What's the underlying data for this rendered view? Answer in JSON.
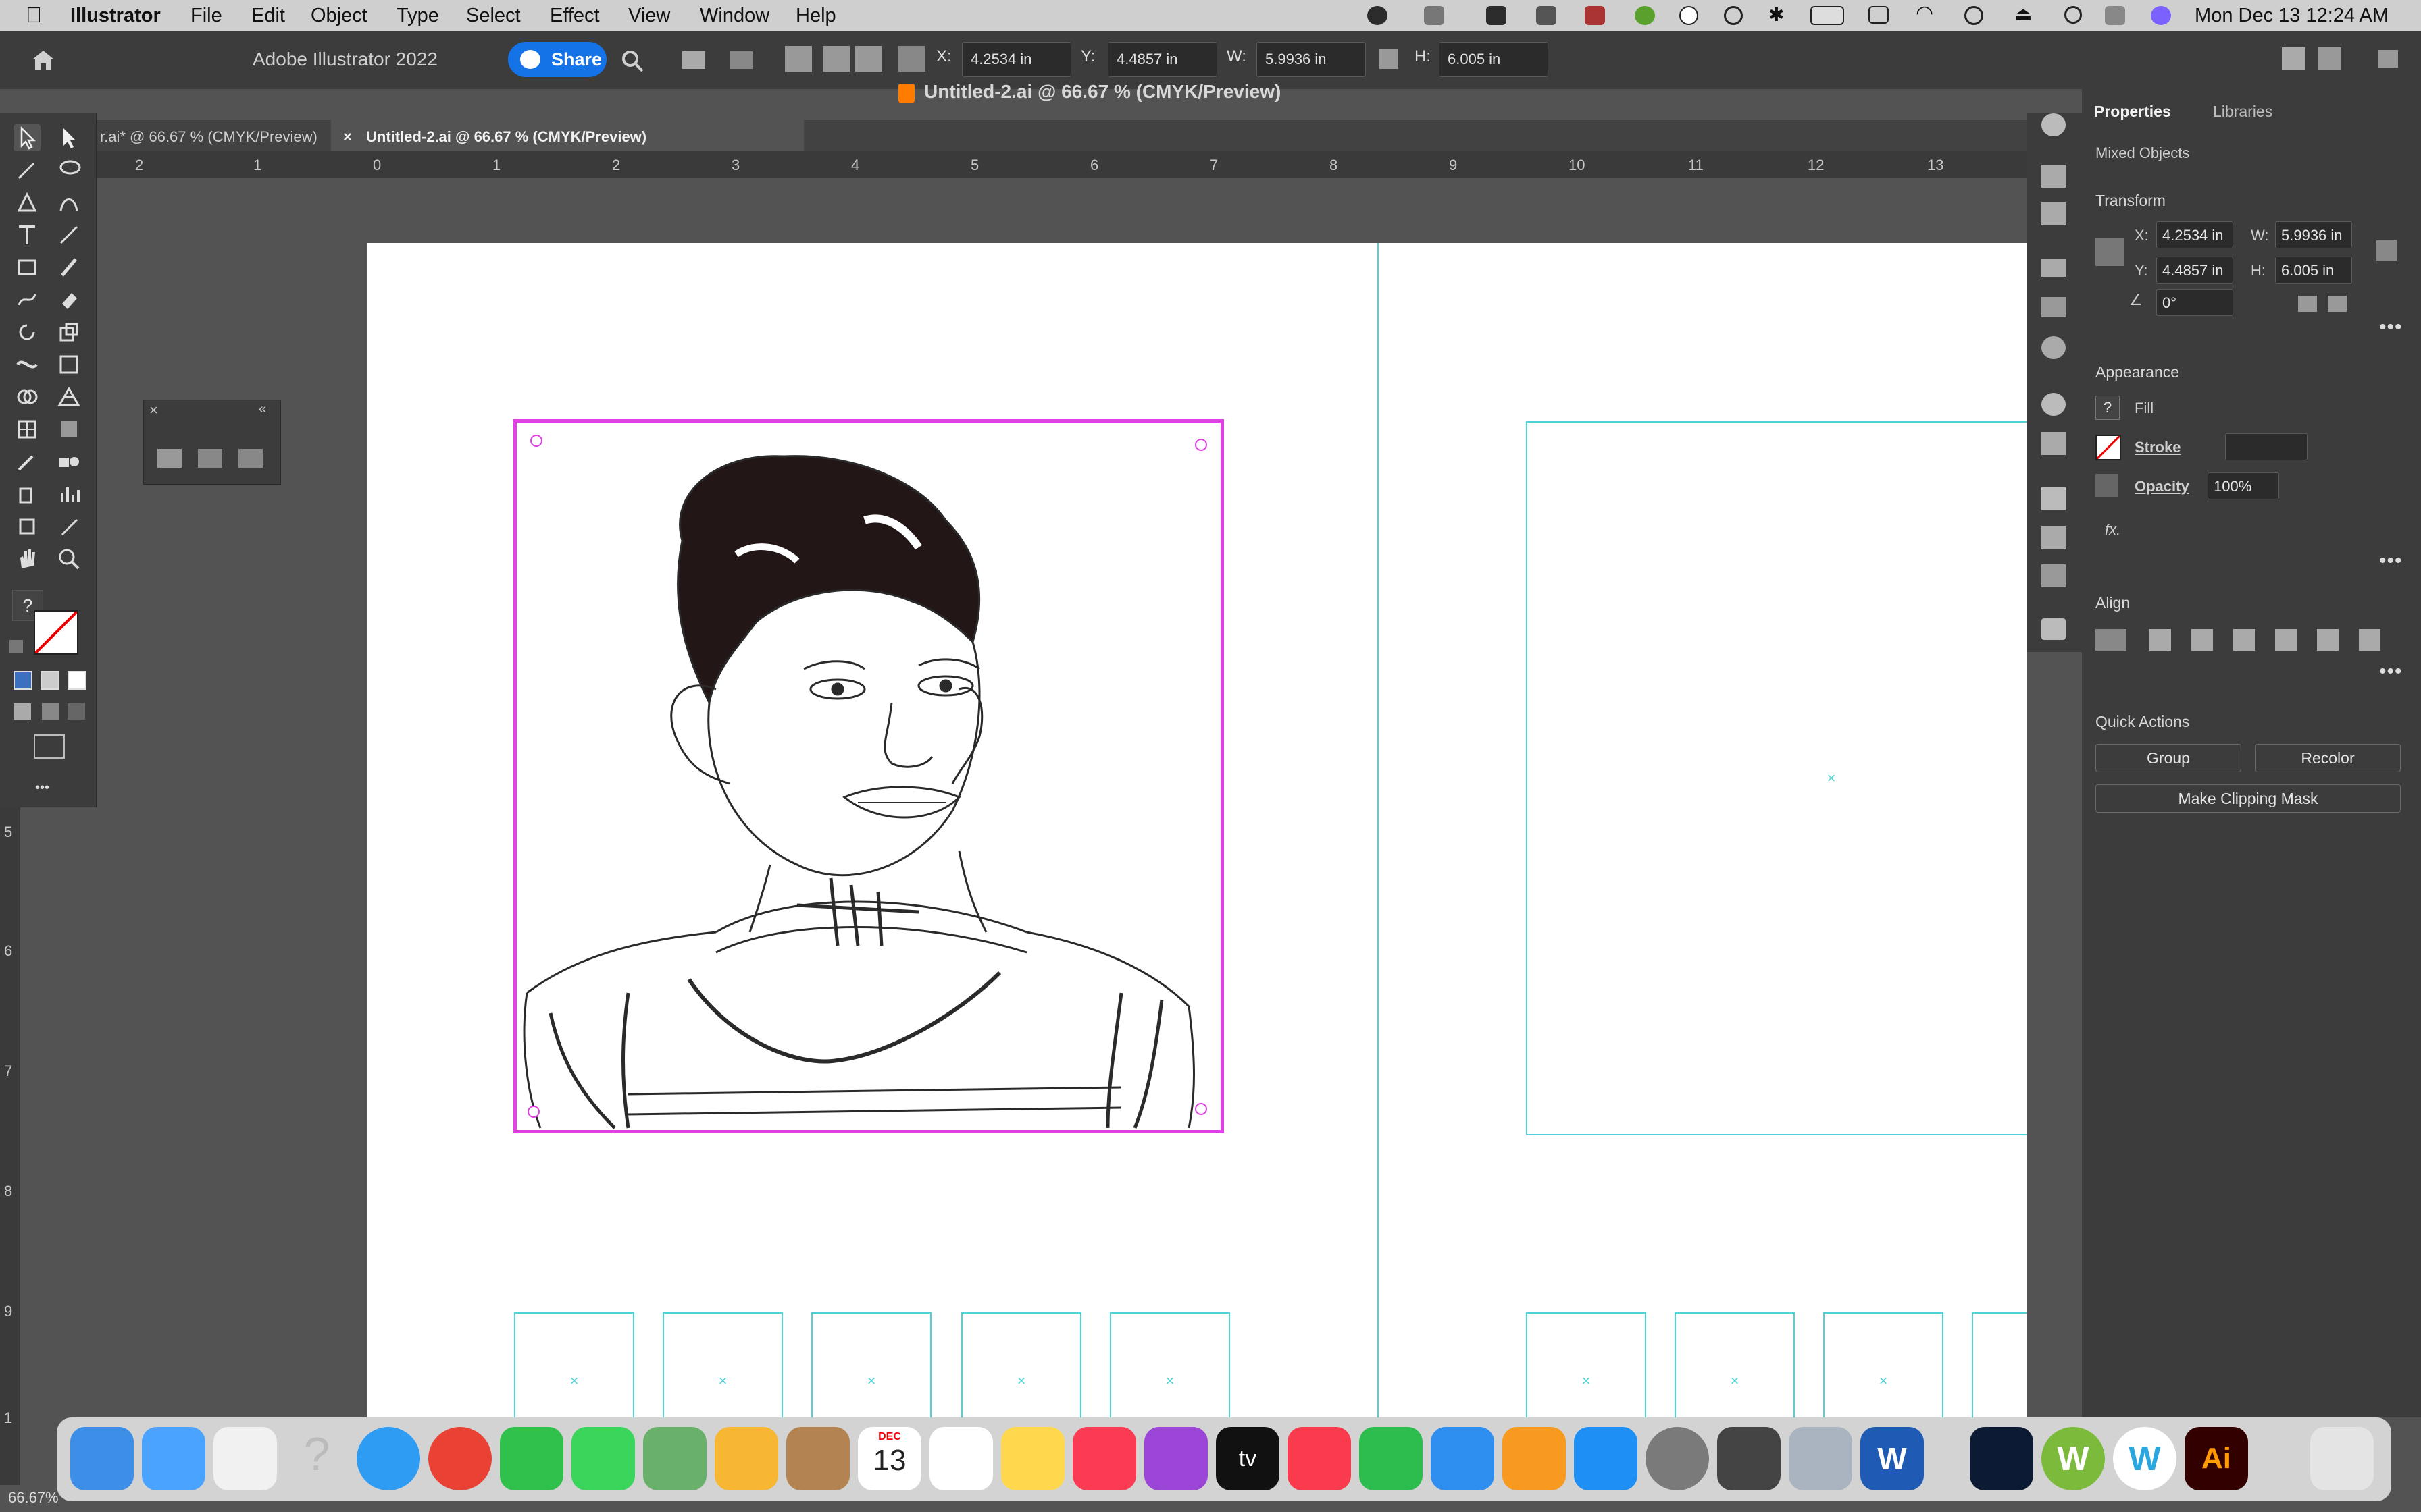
{
  "menubar": {
    "app": "Illustrator",
    "items": [
      "File",
      "Edit",
      "Object",
      "Type",
      "Select",
      "Effect",
      "View",
      "Window",
      "Help"
    ],
    "clock": "Mon Dec 13  12:24 AM"
  },
  "appbar": {
    "title": "Adobe Illustrator 2022",
    "share": "Share",
    "x_label": "X:",
    "x_value": "4.2534 in",
    "y_label": "Y:",
    "y_value": "4.4857 in",
    "w_label": "W:",
    "w_value": "5.9936 in",
    "h_label": "H:",
    "h_value": "6.005 in"
  },
  "document": {
    "title": "Untitled-2.ai @ 66.67 % (CMYK/Preview)",
    "tabs": [
      {
        "label": "r.ai* @ 66.67 % (CMYK/Preview)"
      },
      {
        "label": "Untitled-2.ai @ 66.67 % (CMYK/Preview)",
        "close": "×"
      }
    ],
    "zoom": "66.67%"
  },
  "rulers": {
    "h_ticks": [
      "2",
      "1",
      "0",
      "1",
      "2",
      "3",
      "4",
      "5",
      "6",
      "7",
      "8",
      "9",
      "10",
      "11",
      "12",
      "13"
    ],
    "v_ticks": [
      "5",
      "6",
      "7",
      "8",
      "9",
      "1"
    ]
  },
  "properties": {
    "tab_properties": "Properties",
    "tab_libraries": "Libraries",
    "selection_type": "Mixed Objects",
    "transform": {
      "heading": "Transform",
      "x_label": "X:",
      "x": "4.2534 in",
      "y_label": "Y:",
      "y": "4.4857 in",
      "w_label": "W:",
      "w": "5.9936 in",
      "h_label": "H:",
      "h": "6.005 in",
      "angle": "0°"
    },
    "appearance": {
      "heading": "Appearance",
      "fill": "Fill",
      "fill_icon": "?",
      "stroke": "Stroke",
      "opacity_label": "Opacity",
      "opacity": "100%",
      "fx": "fx."
    },
    "align": {
      "heading": "Align"
    },
    "quick_actions": {
      "heading": "Quick Actions",
      "group": "Group",
      "recolor": "Recolor",
      "clip": "Make Clipping Mask"
    }
  },
  "toolbar": {
    "unknown_fill": "?",
    "more": "•••"
  },
  "dock": {
    "calendar_month": "DEC",
    "calendar_day": "13",
    "tv_label": "tv",
    "word_label": "W",
    "ai_label": "Ai",
    "w2_label": "W"
  },
  "colors": {
    "accent": "#1473e6",
    "selection": "#e23fe6",
    "guides": "#4fd2d6"
  }
}
